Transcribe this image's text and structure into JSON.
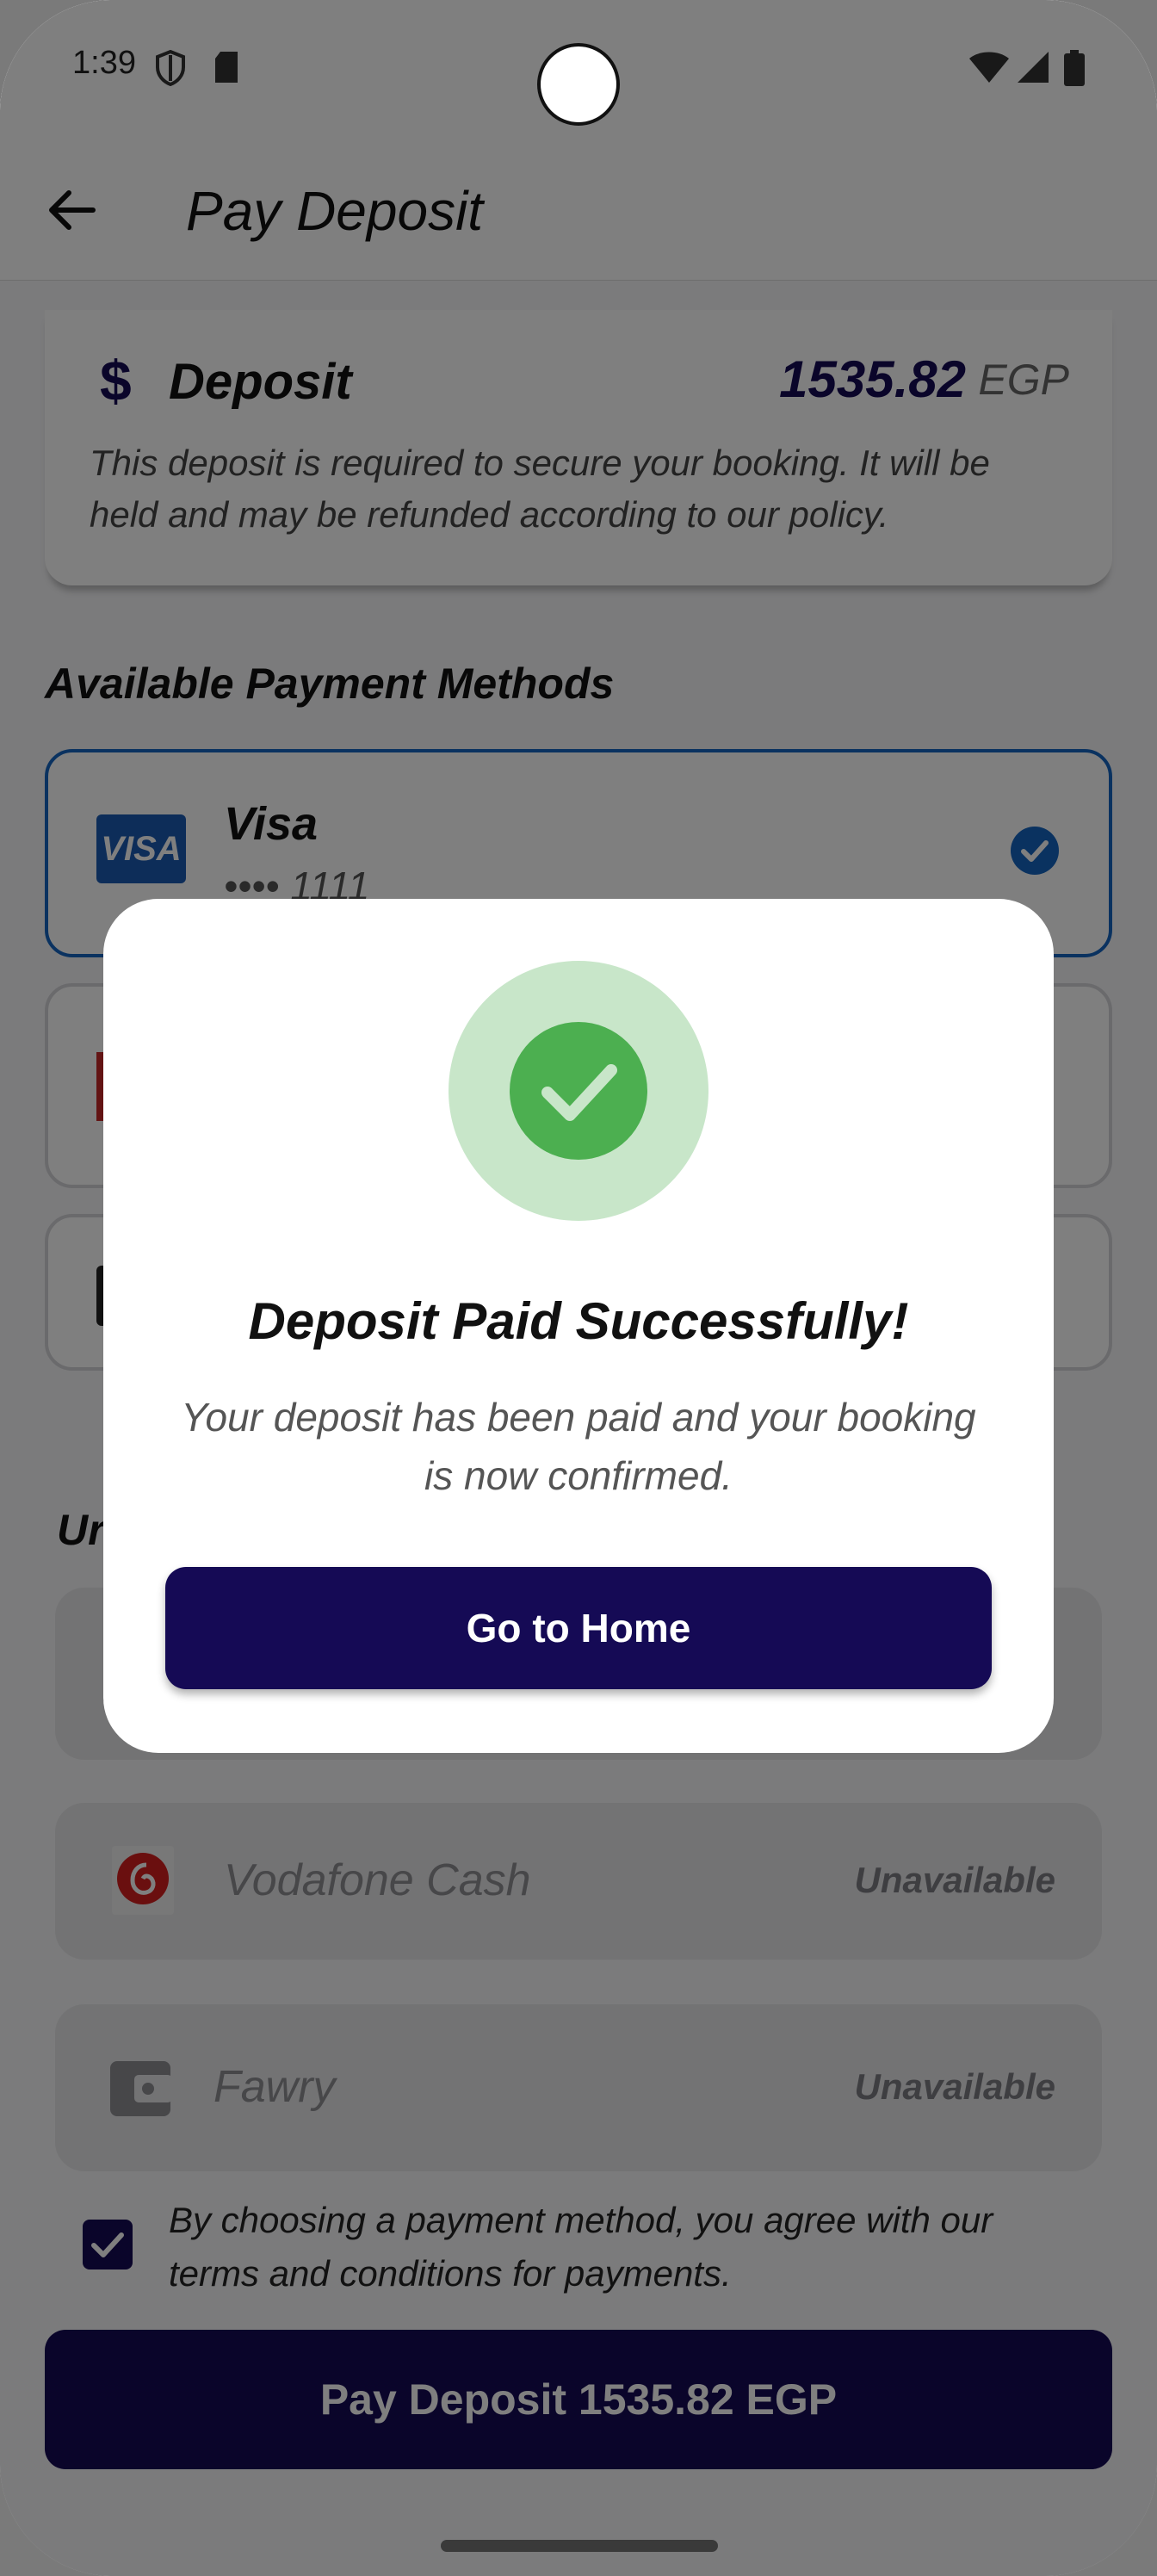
{
  "status_bar": {
    "time": "1:39"
  },
  "app_bar": {
    "title": "Pay Deposit"
  },
  "deposit": {
    "symbol": "$",
    "title": "Deposit",
    "amount": "1535.82",
    "currency": "EGP",
    "description": "This deposit is required to secure your booking. It will be held and may be refunded according to our policy."
  },
  "available_methods": {
    "title": "Available Payment Methods",
    "visa": {
      "logo_text": "VISA",
      "name": "Visa",
      "masked_number": "•••• 1111",
      "selected": true
    }
  },
  "unavailable_methods": {
    "title_fragment": "Ur",
    "items": [
      {
        "name": "Vodafone Cash",
        "status": "Unavailable"
      },
      {
        "name": "Fawry",
        "status": "Unavailable"
      }
    ]
  },
  "terms": {
    "checked": true,
    "text": "By choosing a payment method, you agree with our terms and conditions for payments."
  },
  "pay_button": {
    "label": "Pay Deposit 1535.82 EGP"
  },
  "dialog": {
    "title": "Deposit Paid Successfully!",
    "message": "Your deposit has been paid and your booking is now confirmed.",
    "button_label": "Go to Home"
  },
  "colors": {
    "primary": "#150a55",
    "selected_border": "#1565c0",
    "success": "#4caf50",
    "success_light": "#c8e6c9"
  }
}
